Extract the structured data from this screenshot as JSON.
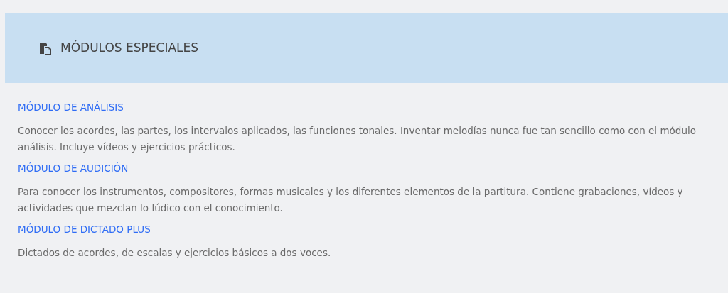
{
  "header": {
    "title": "MÓDULOS ESPECIALES"
  },
  "modules": [
    {
      "title": "MÓDULO DE ANÁLISIS",
      "description": "Conocer los acordes, las partes, los intervalos aplicados, las funciones tonales. Inventar melodías nunca fue tan sencillo como con el módulo análisis. Incluye vídeos y ejercicios prácticos."
    },
    {
      "title": "MÓDULO DE AUDICIÓN",
      "description": "Para conocer los instrumentos, compositores, formas musicales y los diferentes elementos de la partitura. Contiene grabaciones, vídeos y actividades que mezclan lo lúdico con el conocimiento."
    },
    {
      "title": "MÓDULO DE DICTADO PLUS",
      "description": "Dictados de acordes, de escalas y ejercicios básicos a dos voces."
    }
  ]
}
